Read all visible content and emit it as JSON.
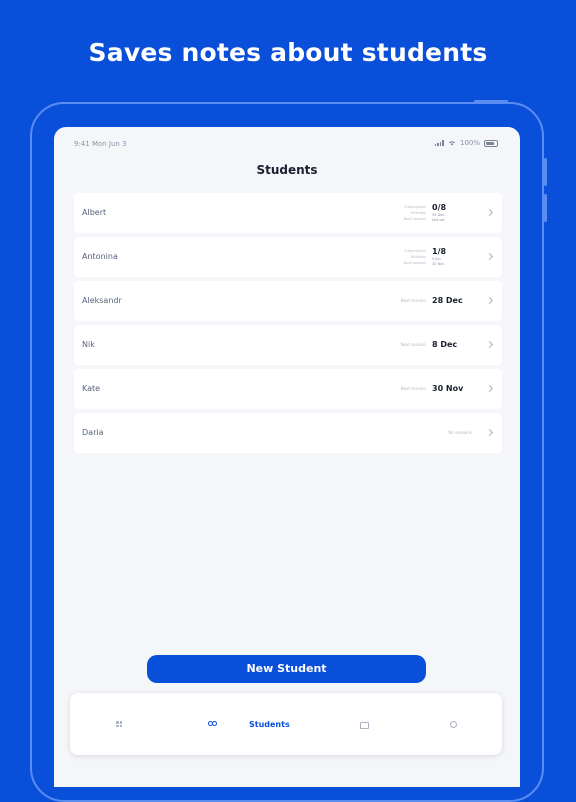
{
  "headline": "Saves notes about students",
  "status_bar": {
    "time": "9:41 Mon Jun 3",
    "battery": "100%"
  },
  "screen_title": "Students",
  "students": [
    {
      "name": "Albert",
      "stat_labels": [
        "Subscription",
        "Birthday",
        "Next session"
      ],
      "stat_main": "0/8",
      "stat_subs": [
        "30 Dec",
        "Not set"
      ]
    },
    {
      "name": "Antonina",
      "stat_labels": [
        "Subscription",
        "Birthday",
        "Next session"
      ],
      "stat_main": "1/8",
      "stat_subs": [
        "5 Jan",
        "30 Nov"
      ]
    },
    {
      "name": "Aleksandr",
      "label": "Next session",
      "value": "28 Dec"
    },
    {
      "name": "Nik",
      "label": "Next session",
      "value": "8 Dec"
    },
    {
      "name": "Kate",
      "label": "Next session",
      "value": "30 Nov"
    },
    {
      "name": "Daria",
      "empty_label": "No sessions"
    }
  ],
  "new_student_label": "New Student",
  "tab_bar": {
    "active_label": "Students"
  },
  "colors": {
    "accent": "#0a4fd9",
    "background": "#f4f6fa",
    "text_dark": "#1a2030"
  },
  "icons": [
    "grid-icon",
    "people-icon",
    "cake-icon",
    "gear-icon",
    "chevron-right-icon",
    "signal-icon",
    "wifi-icon",
    "battery-icon"
  ]
}
